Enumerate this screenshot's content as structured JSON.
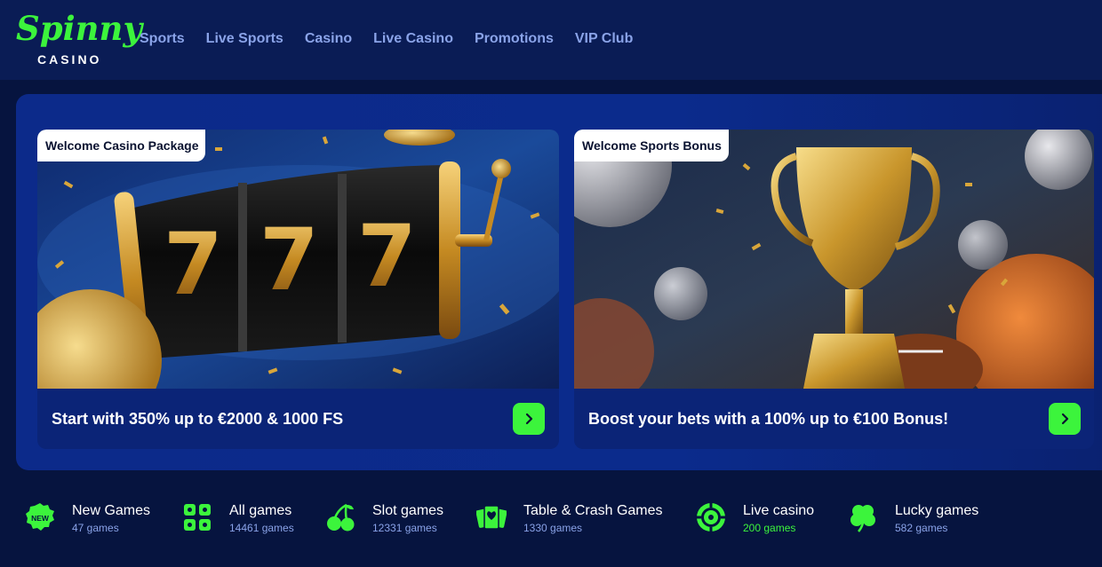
{
  "brand": {
    "logo_word": "Spinny",
    "logo_sub": "CASINO"
  },
  "nav": [
    "Sports",
    "Live Sports",
    "Casino",
    "Live Casino",
    "Promotions",
    "VIP Club"
  ],
  "promos": [
    {
      "tag": "Welcome Casino Package",
      "caption": "Start with 350% up to €2000 & 1000 FS"
    },
    {
      "tag": "Welcome Sports Bonus",
      "caption": "Boost your bets with a 100% up to €100 Bonus!"
    }
  ],
  "slot_symbols": [
    "7",
    "7",
    "7"
  ],
  "categories": [
    {
      "name": "New Games",
      "count": "47 games",
      "icon": "new-badge-icon",
      "badge_text": "NEW"
    },
    {
      "name": "All games",
      "count": "14461 games",
      "icon": "grid-icon"
    },
    {
      "name": "Slot games",
      "count": "12331 games",
      "icon": "cherries-icon"
    },
    {
      "name": "Table & Crash Games",
      "count": "1330 games",
      "icon": "cards-icon"
    },
    {
      "name": "Live casino",
      "count": "200 games",
      "icon": "roulette-icon"
    },
    {
      "name": "Lucky games",
      "count": "582 games",
      "icon": "clover-icon"
    }
  ],
  "colors": {
    "accent": "#3cf43c",
    "header": "#0a1c55",
    "nav_text": "#8aa3e8",
    "panel": "#0c2a8a",
    "page": "#06143f"
  }
}
